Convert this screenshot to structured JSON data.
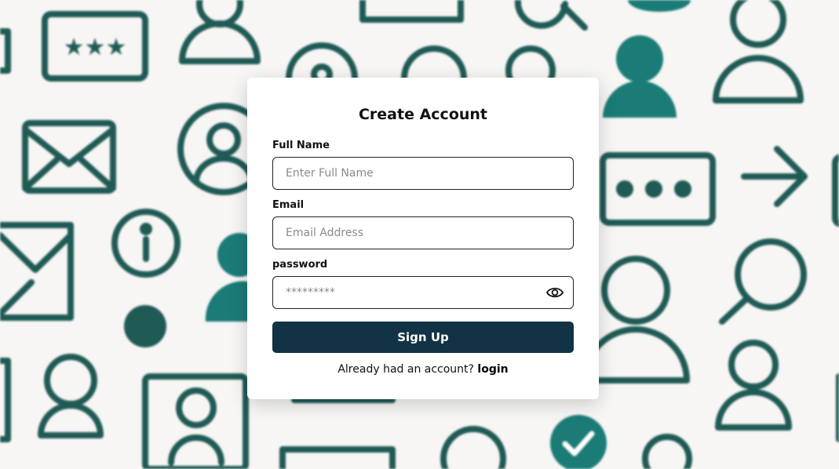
{
  "form": {
    "title": "Create Account",
    "full_name": {
      "label": "Full Name",
      "placeholder": "Enter Full Name"
    },
    "email": {
      "label": "Email",
      "placeholder": "Email Address"
    },
    "password": {
      "label": "password",
      "placeholder": "*********"
    },
    "submit_label": "Sign Up",
    "footer_text": "Already had an account? ",
    "login_link": "login"
  },
  "colors": {
    "icon_teal_dark": "#1f5a55",
    "icon_teal": "#1b7b77",
    "button": "#123246"
  },
  "background_icons": [
    "password-icon",
    "user-icon",
    "mail-icon",
    "user-circle-icon",
    "info-icon",
    "lock-icon",
    "search-icon",
    "more-icon",
    "arrow-right-icon",
    "check-circle-icon",
    "id-card-icon"
  ]
}
